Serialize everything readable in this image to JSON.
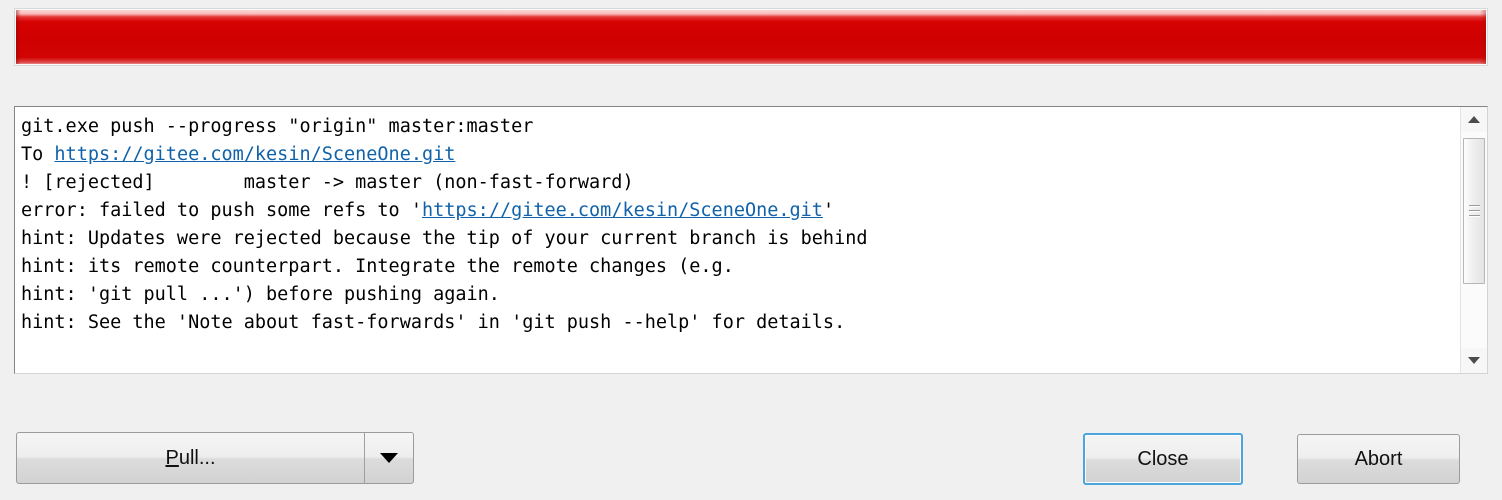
{
  "progress": {
    "name": "push-progress-bar",
    "value_percent": 100,
    "fill_color": "#cf0000",
    "highlight_color": "#f8bcbc",
    "track_color": "#fafafa"
  },
  "console": {
    "name": "git-output-console",
    "background": "#ffffff",
    "text_color": "#000000",
    "link_color": "#1062aa",
    "lines": [
      {
        "id": "line-command",
        "segments": [
          {
            "text": "git.exe push --progress \"origin\" master:master",
            "link": false
          }
        ]
      },
      {
        "id": "line-to-remote",
        "segments": [
          {
            "text": "To ",
            "link": false
          },
          {
            "text": "https://gitee.com/kesin/SceneOne.git",
            "link": true
          }
        ]
      },
      {
        "id": "line-rejected",
        "segments": [
          {
            "text": "! [rejected]        master -> master (non-fast-forward)",
            "link": false
          }
        ]
      },
      {
        "id": "line-error",
        "segments": [
          {
            "text": "error: failed to push some refs to '",
            "link": false
          },
          {
            "text": "https://gitee.com/kesin/SceneOne.git",
            "link": true
          },
          {
            "text": "'",
            "link": false
          }
        ]
      },
      {
        "id": "line-hint-1",
        "segments": [
          {
            "text": "hint: Updates were rejected because the tip of your current branch is behind",
            "link": false
          }
        ]
      },
      {
        "id": "line-hint-2",
        "segments": [
          {
            "text": "hint: its remote counterpart. Integrate the remote changes (e.g.",
            "link": false
          }
        ]
      },
      {
        "id": "line-hint-3",
        "segments": [
          {
            "text": "hint: 'git pull ...') before pushing again.",
            "link": false
          }
        ]
      },
      {
        "id": "line-hint-4",
        "segments": [
          {
            "text": "hint: See the 'Note about fast-forwards' in 'git push --help' for details.",
            "link": false
          }
        ]
      }
    ]
  },
  "scrollbar": {
    "name": "console-scrollbar",
    "up_arrow_icon": "triangle-up-icon",
    "down_arrow_icon": "triangle-down-icon",
    "grip_icon": "grip-lines-icon"
  },
  "buttons": {
    "pull": {
      "label_prefix": "",
      "accelerator": "P",
      "label_suffix": "ull...",
      "full_label": "Pull...",
      "dropdown_icon": "caret-down-icon"
    },
    "close": {
      "label": "Close",
      "is_default": true,
      "focus_color": "#4ba6dd"
    },
    "abort": {
      "label": "Abort",
      "is_default": false
    }
  }
}
